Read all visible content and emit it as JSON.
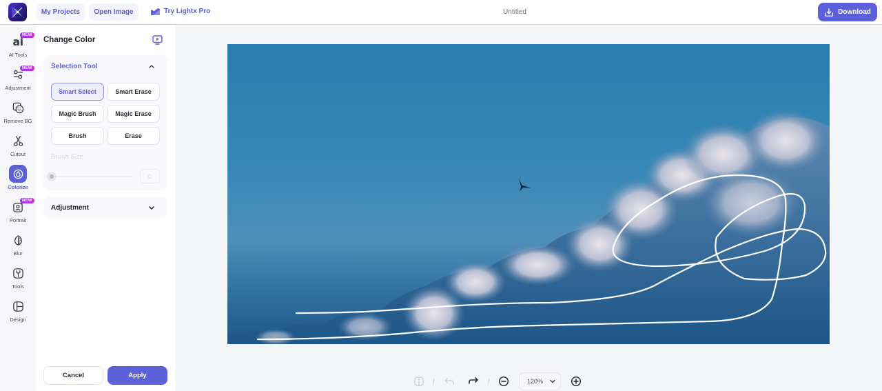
{
  "header": {
    "my_projects": "My Projects",
    "open_image": "Open Image",
    "try_pro": "Try Lightx Pro",
    "document_title": "Untitled",
    "download": "Download"
  },
  "rail": {
    "new_badge": "NEW",
    "ai_glyph": "ai",
    "items": [
      {
        "label": "AI Tools",
        "icon": "ai-icon",
        "new": true,
        "active": false
      },
      {
        "label": "Adjustment",
        "icon": "sliders-icon",
        "new": true,
        "active": false
      },
      {
        "label": "Remove BG",
        "icon": "remove-bg-icon",
        "new": false,
        "active": false
      },
      {
        "label": "Cutout",
        "icon": "scissors-icon",
        "new": false,
        "active": false
      },
      {
        "label": "Colorize",
        "icon": "droplet-icon",
        "new": false,
        "active": true
      },
      {
        "label": "Portrait",
        "icon": "portrait-icon",
        "new": true,
        "active": false
      },
      {
        "label": "Blur",
        "icon": "leaf-icon",
        "new": false,
        "active": false
      },
      {
        "label": "Tools",
        "icon": "wrench-icon",
        "new": false,
        "active": false
      },
      {
        "label": "Design",
        "icon": "layout-icon",
        "new": false,
        "active": false
      }
    ]
  },
  "panel": {
    "title": "Change Color",
    "selection_tool": {
      "heading": "Selection Tool",
      "expanded": true,
      "tools": [
        {
          "label": "Smart Select",
          "selected": true
        },
        {
          "label": "Smart Erase",
          "selected": false
        },
        {
          "label": "Magic Brush",
          "selected": false
        },
        {
          "label": "Magic Erase",
          "selected": false
        },
        {
          "label": "Brush",
          "selected": false
        },
        {
          "label": "Erase",
          "selected": false
        }
      ],
      "brush_size_label": "Brush Size",
      "brush_size_value": "0",
      "brush_size_enabled": false
    },
    "adjustment": {
      "heading": "Adjustment",
      "expanded": false
    },
    "cancel": "Cancel",
    "apply": "Apply"
  },
  "canvas": {
    "image_description": "Blue sky with clouds and a flying bird, with white freehand selection strokes"
  },
  "bottom_toolbar": {
    "zoom_level": "120%"
  },
  "colors": {
    "accent": "#5d61d9",
    "badge_gradient_start": "#8c3cf0",
    "badge_gradient_end": "#d22fd0"
  }
}
